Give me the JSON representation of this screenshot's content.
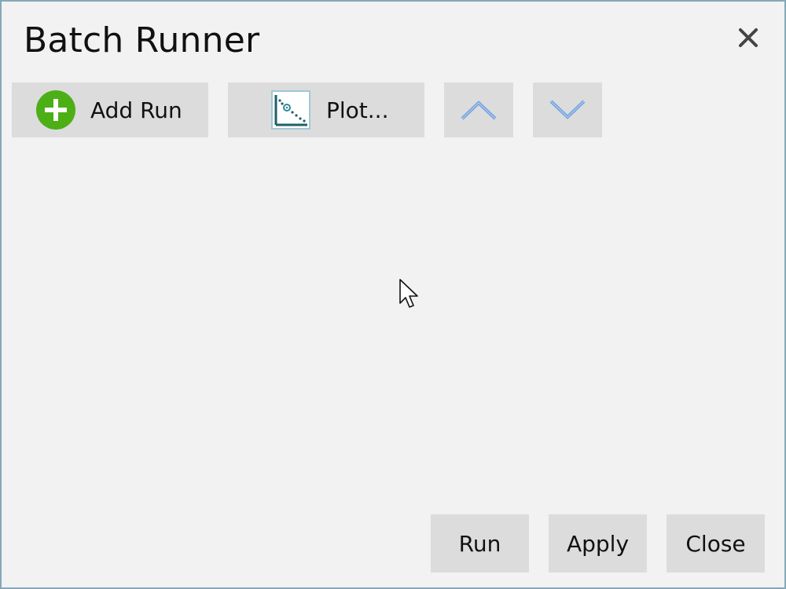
{
  "window": {
    "title": "Batch Runner"
  },
  "toolbar": {
    "add_run_label": "Add Run",
    "plot_label": "Plot..."
  },
  "footer": {
    "run_label": "Run",
    "apply_label": "Apply",
    "close_label": "Close"
  },
  "icons": {
    "close": "close-icon",
    "add": "add-circle-icon",
    "plot": "plot-icon",
    "up": "chevron-up-icon",
    "down": "chevron-down-icon"
  },
  "colors": {
    "window_border": "#84a8b8",
    "background": "#f2f2f2",
    "button": "#dcdcdc",
    "add_green": "#4caf16",
    "chevron_blue": "#6e9fdc",
    "plot_teal": "#2b8a9a"
  }
}
